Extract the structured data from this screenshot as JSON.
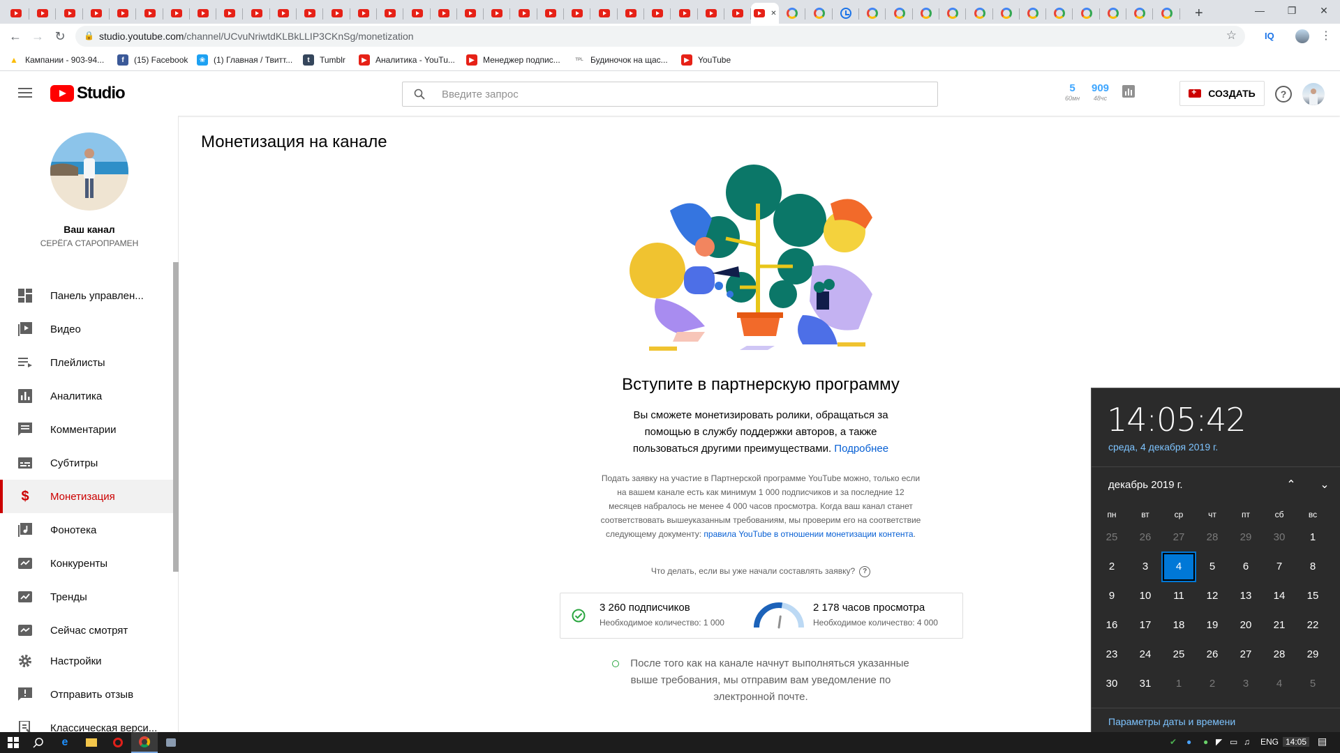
{
  "browser": {
    "url_host": "studio.youtube.com",
    "url_path": "/channel/UCvuNriwtdKLBkLLIP3CKnSg/monetization",
    "iq_label": "IQ"
  },
  "bookmarks": [
    {
      "label": "Кампании - 903-94...",
      "icon": "google-ads-icon",
      "color": "#fbbc05"
    },
    {
      "label": "(15) Facebook",
      "icon": "facebook-icon",
      "color": "#3b5998"
    },
    {
      "label": "(1) Главная / Твитт...",
      "icon": "twitter-icon",
      "color": "#1da1f2"
    },
    {
      "label": "Tumblr",
      "icon": "tumblr-icon",
      "color": "#35465c"
    },
    {
      "label": "Аналитика - YouTu...",
      "icon": "youtube-icon",
      "color": "#e62117"
    },
    {
      "label": "Менеджер подпис...",
      "icon": "youtube-icon",
      "color": "#e62117"
    },
    {
      "label": "Будиночок на щас...",
      "icon": "tpl-icon",
      "color": "#888888"
    },
    {
      "label": "YouTube",
      "icon": "youtube-icon",
      "color": "#e62117"
    }
  ],
  "header": {
    "logo_text": "Studio",
    "search_placeholder": "Введите запрос",
    "realtime": [
      {
        "value": "5",
        "unit": "60мн"
      },
      {
        "value": "909",
        "unit": "48чс"
      }
    ],
    "create_label": "СОЗДАТЬ",
    "help_label": "?"
  },
  "sidebar": {
    "channel_name": "Ваш канал",
    "channel_owner": "СЕРЁГА СТАРОПРАМЕН",
    "items": [
      {
        "label": "Панель управлен...",
        "icon": "dashboard-icon"
      },
      {
        "label": "Видео",
        "icon": "video-icon"
      },
      {
        "label": "Плейлисты",
        "icon": "playlist-icon"
      },
      {
        "label": "Аналитика",
        "icon": "analytics-icon"
      },
      {
        "label": "Комментарии",
        "icon": "comments-icon"
      },
      {
        "label": "Субтитры",
        "icon": "subtitles-icon"
      },
      {
        "label": "Монетизация",
        "icon": "dollar-icon",
        "active": true
      },
      {
        "label": "Фонотека",
        "icon": "audio-library-icon"
      },
      {
        "label": "Конкуренты",
        "icon": "competitors-icon"
      },
      {
        "label": "Тренды",
        "icon": "trends-icon"
      },
      {
        "label": "Сейчас смотрят",
        "icon": "watching-now-icon"
      },
      {
        "label": "Настройки",
        "icon": "settings-icon"
      },
      {
        "label": "Отправить отзыв",
        "icon": "feedback-icon"
      },
      {
        "label": "Классическая верси...",
        "icon": "classic-icon"
      }
    ]
  },
  "main": {
    "page_title": "Монетизация на канале",
    "hero_title": "Вступите в партнерскую программу",
    "hero_desc": "Вы сможете монетизировать ролики, обращаться за помощью в службу поддержки авторов, а также пользоваться другими преимуществами.",
    "hero_link": "Подробнее",
    "requirements_text": "Подать заявку на участие в Партнерской программе YouTube можно, только если на вашем канале есть как минимум 1 000 подписчиков и за последние 12 месяцев набралось не менее 4 000 часов просмотра. Когда ваш канал станет соответствовать вышеуказанным требованиям, мы проверим его на соответствие следующему документу:",
    "requirements_link": "правила YouTube в отношении монетизации контента",
    "apply_question": "Что делать, если вы уже начали составлять заявку?",
    "subscribers": {
      "value": "3 260 подписчиков",
      "required": "Необходимое количество: 1 000"
    },
    "watch_hours": {
      "value": "2 178 часов просмотра",
      "required": "Необходимое количество: 4 000",
      "progress": 0.5445
    },
    "notice": "После того как на канале начнут выполняться указанные выше требования, мы отправим вам уведомление по электронной почте."
  },
  "calendar": {
    "time": "14:05:42",
    "date": "среда, 4 декабря 2019 г.",
    "month": "декабрь 2019 г.",
    "weekdays": [
      "пн",
      "вт",
      "ср",
      "чт",
      "пт",
      "сб",
      "вс"
    ],
    "days": [
      [
        "25",
        "26",
        "27",
        "28",
        "29",
        "30",
        "1"
      ],
      [
        "2",
        "3",
        "4",
        "5",
        "6",
        "7",
        "8"
      ],
      [
        "9",
        "10",
        "11",
        "12",
        "13",
        "14",
        "15"
      ],
      [
        "16",
        "17",
        "18",
        "19",
        "20",
        "21",
        "22"
      ],
      [
        "23",
        "24",
        "25",
        "26",
        "27",
        "28",
        "29"
      ],
      [
        "30",
        "31",
        "1",
        "2",
        "3",
        "4",
        "5"
      ]
    ],
    "today": "4",
    "settings_link": "Параметры даты и времени"
  },
  "taskbar": {
    "lang": "ENG",
    "clock": "14:05"
  }
}
